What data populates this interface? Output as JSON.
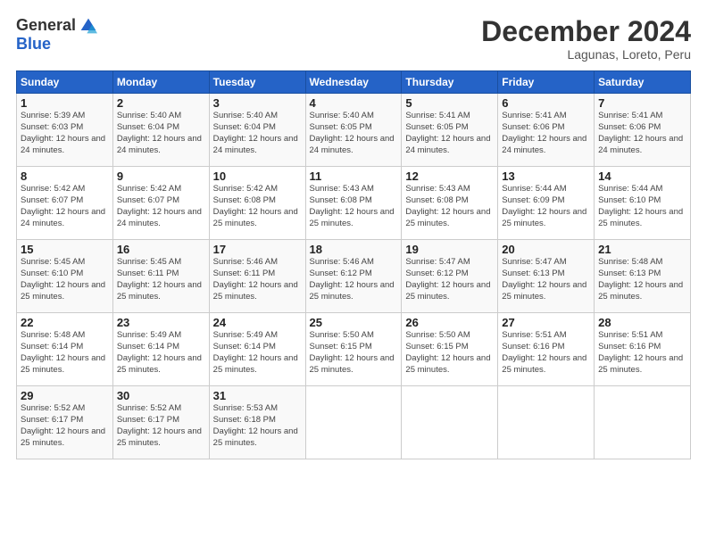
{
  "logo": {
    "general": "General",
    "blue": "Blue"
  },
  "header": {
    "month": "December 2024",
    "location": "Lagunas, Loreto, Peru"
  },
  "days_of_week": [
    "Sunday",
    "Monday",
    "Tuesday",
    "Wednesday",
    "Thursday",
    "Friday",
    "Saturday"
  ],
  "weeks": [
    [
      {
        "day": "1",
        "sunrise": "5:39 AM",
        "sunset": "6:03 PM",
        "daylight": "12 hours and 24 minutes."
      },
      {
        "day": "2",
        "sunrise": "5:40 AM",
        "sunset": "6:04 PM",
        "daylight": "12 hours and 24 minutes."
      },
      {
        "day": "3",
        "sunrise": "5:40 AM",
        "sunset": "6:04 PM",
        "daylight": "12 hours and 24 minutes."
      },
      {
        "day": "4",
        "sunrise": "5:40 AM",
        "sunset": "6:05 PM",
        "daylight": "12 hours and 24 minutes."
      },
      {
        "day": "5",
        "sunrise": "5:41 AM",
        "sunset": "6:05 PM",
        "daylight": "12 hours and 24 minutes."
      },
      {
        "day": "6",
        "sunrise": "5:41 AM",
        "sunset": "6:06 PM",
        "daylight": "12 hours and 24 minutes."
      },
      {
        "day": "7",
        "sunrise": "5:41 AM",
        "sunset": "6:06 PM",
        "daylight": "12 hours and 24 minutes."
      }
    ],
    [
      {
        "day": "8",
        "sunrise": "5:42 AM",
        "sunset": "6:07 PM",
        "daylight": "12 hours and 24 minutes."
      },
      {
        "day": "9",
        "sunrise": "5:42 AM",
        "sunset": "6:07 PM",
        "daylight": "12 hours and 24 minutes."
      },
      {
        "day": "10",
        "sunrise": "5:42 AM",
        "sunset": "6:08 PM",
        "daylight": "12 hours and 25 minutes."
      },
      {
        "day": "11",
        "sunrise": "5:43 AM",
        "sunset": "6:08 PM",
        "daylight": "12 hours and 25 minutes."
      },
      {
        "day": "12",
        "sunrise": "5:43 AM",
        "sunset": "6:08 PM",
        "daylight": "12 hours and 25 minutes."
      },
      {
        "day": "13",
        "sunrise": "5:44 AM",
        "sunset": "6:09 PM",
        "daylight": "12 hours and 25 minutes."
      },
      {
        "day": "14",
        "sunrise": "5:44 AM",
        "sunset": "6:10 PM",
        "daylight": "12 hours and 25 minutes."
      }
    ],
    [
      {
        "day": "15",
        "sunrise": "5:45 AM",
        "sunset": "6:10 PM",
        "daylight": "12 hours and 25 minutes."
      },
      {
        "day": "16",
        "sunrise": "5:45 AM",
        "sunset": "6:11 PM",
        "daylight": "12 hours and 25 minutes."
      },
      {
        "day": "17",
        "sunrise": "5:46 AM",
        "sunset": "6:11 PM",
        "daylight": "12 hours and 25 minutes."
      },
      {
        "day": "18",
        "sunrise": "5:46 AM",
        "sunset": "6:12 PM",
        "daylight": "12 hours and 25 minutes."
      },
      {
        "day": "19",
        "sunrise": "5:47 AM",
        "sunset": "6:12 PM",
        "daylight": "12 hours and 25 minutes."
      },
      {
        "day": "20",
        "sunrise": "5:47 AM",
        "sunset": "6:13 PM",
        "daylight": "12 hours and 25 minutes."
      },
      {
        "day": "21",
        "sunrise": "5:48 AM",
        "sunset": "6:13 PM",
        "daylight": "12 hours and 25 minutes."
      }
    ],
    [
      {
        "day": "22",
        "sunrise": "5:48 AM",
        "sunset": "6:14 PM",
        "daylight": "12 hours and 25 minutes."
      },
      {
        "day": "23",
        "sunrise": "5:49 AM",
        "sunset": "6:14 PM",
        "daylight": "12 hours and 25 minutes."
      },
      {
        "day": "24",
        "sunrise": "5:49 AM",
        "sunset": "6:14 PM",
        "daylight": "12 hours and 25 minutes."
      },
      {
        "day": "25",
        "sunrise": "5:50 AM",
        "sunset": "6:15 PM",
        "daylight": "12 hours and 25 minutes."
      },
      {
        "day": "26",
        "sunrise": "5:50 AM",
        "sunset": "6:15 PM",
        "daylight": "12 hours and 25 minutes."
      },
      {
        "day": "27",
        "sunrise": "5:51 AM",
        "sunset": "6:16 PM",
        "daylight": "12 hours and 25 minutes."
      },
      {
        "day": "28",
        "sunrise": "5:51 AM",
        "sunset": "6:16 PM",
        "daylight": "12 hours and 25 minutes."
      }
    ],
    [
      {
        "day": "29",
        "sunrise": "5:52 AM",
        "sunset": "6:17 PM",
        "daylight": "12 hours and 25 minutes."
      },
      {
        "day": "30",
        "sunrise": "5:52 AM",
        "sunset": "6:17 PM",
        "daylight": "12 hours and 25 minutes."
      },
      {
        "day": "31",
        "sunrise": "5:53 AM",
        "sunset": "6:18 PM",
        "daylight": "12 hours and 25 minutes."
      },
      null,
      null,
      null,
      null
    ]
  ],
  "labels": {
    "sunrise": "Sunrise:",
    "sunset": "Sunset:",
    "daylight": "Daylight:"
  }
}
